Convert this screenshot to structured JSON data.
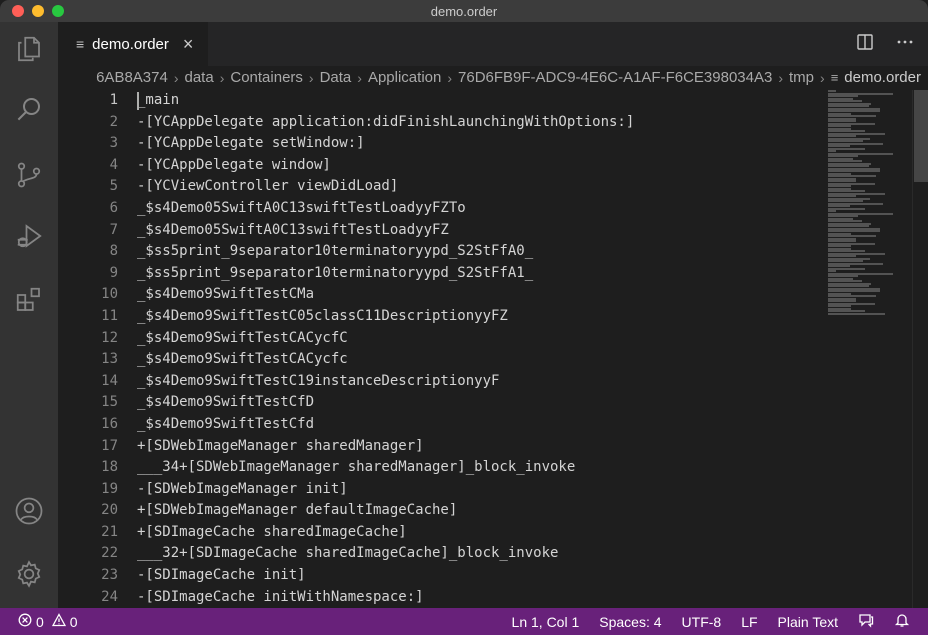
{
  "window": {
    "title": "demo.order"
  },
  "activity_bar": {
    "icons": [
      "explorer-icon",
      "search-icon",
      "source-control-icon",
      "run-debug-icon",
      "extensions-icon",
      "account-icon",
      "settings-gear-icon"
    ]
  },
  "tabs": [
    {
      "label": "demo.order",
      "active": true
    }
  ],
  "breadcrumb": {
    "segments": [
      "6AB8A374",
      "data",
      "Containers",
      "Data",
      "Application",
      "76D6FB9F-ADC9-4E6C-A1AF-F6CE398034A3",
      "tmp"
    ],
    "file": "demo.order"
  },
  "editor": {
    "line_numbers": [
      "1",
      "2",
      "3",
      "4",
      "5",
      "6",
      "7",
      "8",
      "9",
      "10",
      "11",
      "12",
      "13",
      "14",
      "15",
      "16",
      "17",
      "18",
      "19",
      "20",
      "21",
      "22",
      "23",
      "24"
    ],
    "lines": [
      "_main",
      "-[YCAppDelegate application:didFinishLaunchingWithOptions:]",
      "-[YCAppDelegate setWindow:]",
      "-[YCAppDelegate window]",
      "-[YCViewController viewDidLoad]",
      "_$s4Demo05SwiftA0C13swiftTestLoadyyFZTo",
      "_$s4Demo05SwiftA0C13swiftTestLoadyyFZ",
      "_$ss5print_9separator10terminatoryypd_S2StFfA0_",
      "_$ss5print_9separator10terminatoryypd_S2StFfA1_",
      "_$s4Demo9SwiftTestCMa",
      "_$s4Demo9SwiftTestC05classC11DescriptionyyFZ",
      "_$s4Demo9SwiftTestCACycfC",
      "_$s4Demo9SwiftTestCACycfc",
      "_$s4Demo9SwiftTestC19instanceDescriptionyyF",
      "_$s4Demo9SwiftTestCfD",
      "_$s4Demo9SwiftTestCfd",
      "+[SDWebImageManager sharedManager]",
      "___34+[SDWebImageManager sharedManager]_block_invoke",
      "-[SDWebImageManager init]",
      "+[SDWebImageManager defaultImageCache]",
      "+[SDImageCache sharedImageCache]",
      "___32+[SDImageCache sharedImageCache]_block_invoke",
      "-[SDImageCache init]",
      "-[SDImageCache initWithNamespace:]"
    ]
  },
  "status_bar": {
    "errors": "0",
    "warnings": "0",
    "position": "Ln 1, Col 1",
    "indent": "Spaces: 4",
    "encoding": "UTF-8",
    "eol": "LF",
    "language": "Plain Text"
  },
  "colors": {
    "status_bar_bg": "#68217a",
    "editor_bg": "#1e1e1e",
    "activity_bar_bg": "#333333"
  }
}
